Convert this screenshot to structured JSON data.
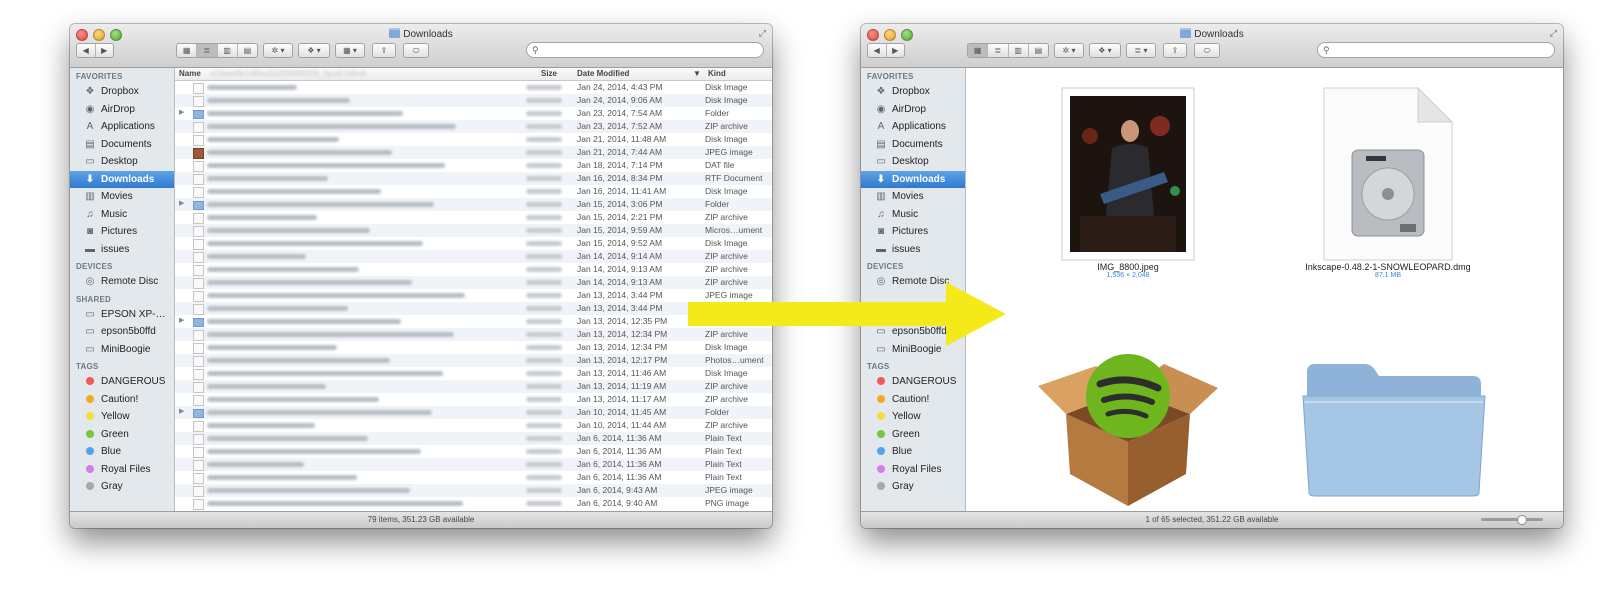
{
  "left_window": {
    "title": "Downloads",
    "header_path": "s2dee49c1465a1020000000!6_hjusb.hdxvb",
    "columns": {
      "name": "Name",
      "size": "Size",
      "date": "Date Modified",
      "kind": "Kind"
    },
    "sidebar": {
      "favorites_label": "FAVORITES",
      "favorites": [
        {
          "label": "Dropbox",
          "icon": "dropbox-icon"
        },
        {
          "label": "AirDrop",
          "icon": "airdrop-icon"
        },
        {
          "label": "Applications",
          "icon": "applications-icon"
        },
        {
          "label": "Documents",
          "icon": "documents-icon"
        },
        {
          "label": "Desktop",
          "icon": "desktop-icon"
        },
        {
          "label": "Downloads",
          "icon": "downloads-icon"
        },
        {
          "label": "Movies",
          "icon": "movies-icon"
        },
        {
          "label": "Music",
          "icon": "music-icon"
        },
        {
          "label": "Pictures",
          "icon": "pictures-icon"
        },
        {
          "label": "issues",
          "icon": "folder-icon"
        }
      ],
      "devices_label": "DEVICES",
      "devices": [
        {
          "label": "Remote Disc",
          "icon": "disc-icon"
        }
      ],
      "shared_label": "SHARED",
      "shared": [
        {
          "label": "EPSON XP-…",
          "icon": "computer-icon"
        },
        {
          "label": "epson5b0ffd",
          "icon": "computer-icon"
        },
        {
          "label": "MiniBoogie",
          "icon": "computer-icon"
        }
      ],
      "tags_label": "TAGS",
      "tags": [
        {
          "label": "DANGEROUS",
          "color": "#f05a5a"
        },
        {
          "label": "Caution!",
          "color": "#f5a623"
        },
        {
          "label": "Yellow",
          "color": "#f2df3a"
        },
        {
          "label": "Green",
          "color": "#7cc33f"
        },
        {
          "label": "Blue",
          "color": "#55a2ec"
        },
        {
          "label": "Royal Files",
          "color": "#d47ee8"
        },
        {
          "label": "Gray",
          "color": "#a8a8a8"
        }
      ]
    },
    "rows": [
      {
        "date": "Jan 24, 2014, 4:43 PM",
        "kind": "Disk Image",
        "type": "file"
      },
      {
        "date": "Jan 24, 2014, 9:06 AM",
        "kind": "Disk Image",
        "type": "file"
      },
      {
        "date": "Jan 23, 2014, 7:54 AM",
        "kind": "Folder",
        "type": "folder"
      },
      {
        "date": "Jan 23, 2014, 7:52 AM",
        "kind": "ZIP archive",
        "type": "file"
      },
      {
        "date": "Jan 21, 2014, 11:48 AM",
        "kind": "Disk Image",
        "type": "file"
      },
      {
        "date": "Jan 21, 2014, 7:44 AM",
        "kind": "JPEG image",
        "type": "image"
      },
      {
        "date": "Jan 18, 2014, 7:14 PM",
        "kind": "DAT file",
        "type": "file"
      },
      {
        "date": "Jan 16, 2014, 8:34 PM",
        "kind": "RTF Document",
        "type": "file"
      },
      {
        "date": "Jan 16, 2014, 11:41 AM",
        "kind": "Disk Image",
        "type": "file"
      },
      {
        "date": "Jan 15, 2014, 3:06 PM",
        "kind": "Folder",
        "type": "folder"
      },
      {
        "date": "Jan 15, 2014, 2:21 PM",
        "kind": "ZIP archive",
        "type": "file"
      },
      {
        "date": "Jan 15, 2014, 9:59 AM",
        "kind": "Micros…ument",
        "type": "file"
      },
      {
        "date": "Jan 15, 2014, 9:52 AM",
        "kind": "Disk Image",
        "type": "file"
      },
      {
        "date": "Jan 14, 2014, 9:14 AM",
        "kind": "ZIP archive",
        "type": "file"
      },
      {
        "date": "Jan 14, 2014, 9:13 AM",
        "kind": "ZIP archive",
        "type": "file"
      },
      {
        "date": "Jan 14, 2014, 9:13 AM",
        "kind": "ZIP archive",
        "type": "file"
      },
      {
        "date": "Jan 13, 2014, 3:44 PM",
        "kind": "JPEG image",
        "type": "file"
      },
      {
        "date": "Jan 13, 2014, 3:44 PM",
        "kind": "",
        "type": "file"
      },
      {
        "date": "Jan 13, 2014, 12:35 PM",
        "kind": "",
        "type": "folder"
      },
      {
        "date": "Jan 13, 2014, 12:34 PM",
        "kind": "ZIP archive",
        "type": "file"
      },
      {
        "date": "Jan 13, 2014, 12:34 PM",
        "kind": "Disk Image",
        "type": "file"
      },
      {
        "date": "Jan 13, 2014, 12:17 PM",
        "kind": "Photos…ument",
        "type": "file"
      },
      {
        "date": "Jan 13, 2014, 11:46 AM",
        "kind": "Disk Image",
        "type": "file"
      },
      {
        "date": "Jan 13, 2014, 11:19 AM",
        "kind": "ZIP archive",
        "type": "file"
      },
      {
        "date": "Jan 13, 2014, 11:17 AM",
        "kind": "ZIP archive",
        "type": "file"
      },
      {
        "date": "Jan 10, 2014, 11:45 AM",
        "kind": "Folder",
        "type": "folder"
      },
      {
        "date": "Jan 10, 2014, 11:44 AM",
        "kind": "ZIP archive",
        "type": "file"
      },
      {
        "date": "Jan 6, 2014, 11:36 AM",
        "kind": "Plain Text",
        "type": "file"
      },
      {
        "date": "Jan 6, 2014, 11:36 AM",
        "kind": "Plain Text",
        "type": "file"
      },
      {
        "date": "Jan 6, 2014, 11:36 AM",
        "kind": "Plain Text",
        "type": "file"
      },
      {
        "date": "Jan 6, 2014, 11:36 AM",
        "kind": "Plain Text",
        "type": "file"
      },
      {
        "date": "Jan 6, 2014, 9:43 AM",
        "kind": "JPEG image",
        "type": "file"
      },
      {
        "date": "Jan 6, 2014, 9:40 AM",
        "kind": "PNG image",
        "type": "file"
      }
    ],
    "status": "79 items, 351.23 GB available"
  },
  "right_window": {
    "title": "Downloads",
    "items": [
      {
        "name": "IMG_8800.jpeg",
        "sub": "1,536 × 2,048",
        "icon": "photo-thumbnail"
      },
      {
        "name": "Inkscape-0.48.2-1-SNOWLEOPARD.dmg",
        "sub": "87.1 MB",
        "icon": "disk-image-icon"
      },
      {
        "name": "",
        "sub": "",
        "icon": "spotify-package-icon"
      },
      {
        "name": "",
        "sub": "",
        "icon": "folder-icon"
      }
    ],
    "status": "1 of 65 selected, 351.22 GB available",
    "sidebar_shared_visible": [
      "epson5b0ffd",
      "MiniBoogie"
    ]
  },
  "arrow_color": "#f4ea1a"
}
